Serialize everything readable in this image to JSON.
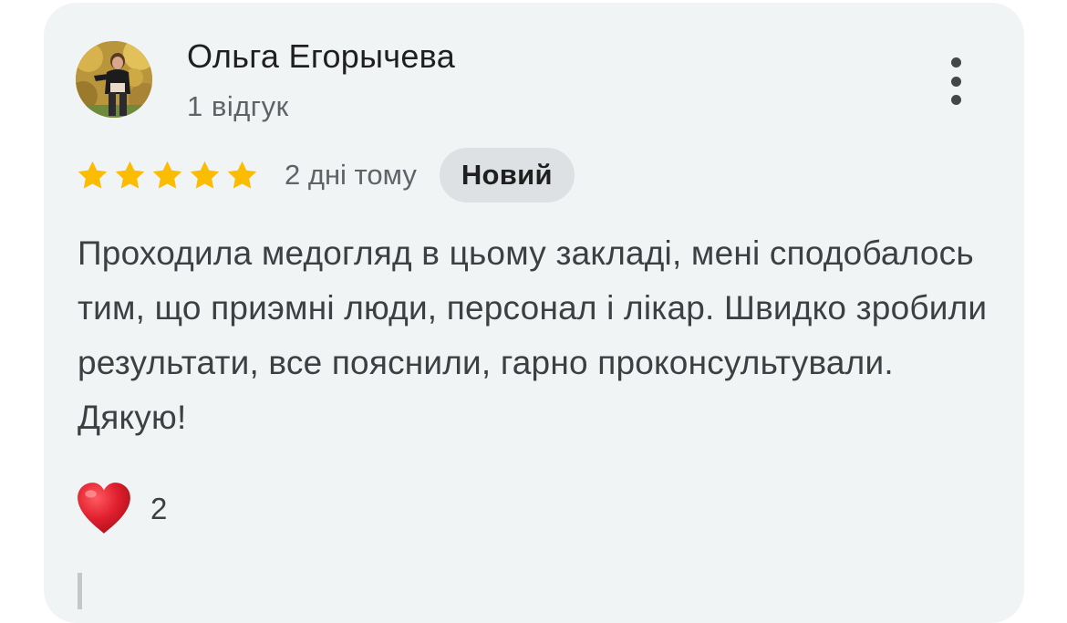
{
  "reviewer": {
    "name": "Ольга Егорычева",
    "review_count": "1 відгук",
    "avatar_icon": "user-avatar-photo"
  },
  "menu": {
    "icon": "more-vert-icon"
  },
  "rating": {
    "stars": 5,
    "max_stars": 5,
    "star_color": "#fbbc04",
    "date": "2 дні тому",
    "badge": "Новий"
  },
  "review": {
    "text": "Проходила медогляд в цьому закладі, мені сподобалось тим, що приэмні люди, персонал і лікар. Швидко зробили результати, все пояснили, гарно проконсультували. Дякую!"
  },
  "reaction": {
    "icon": "red-heart-icon",
    "count": "2"
  },
  "colors": {
    "card_background": "#f1f4f5",
    "badge_background": "#dde1e3",
    "heart": "#e0202e"
  }
}
